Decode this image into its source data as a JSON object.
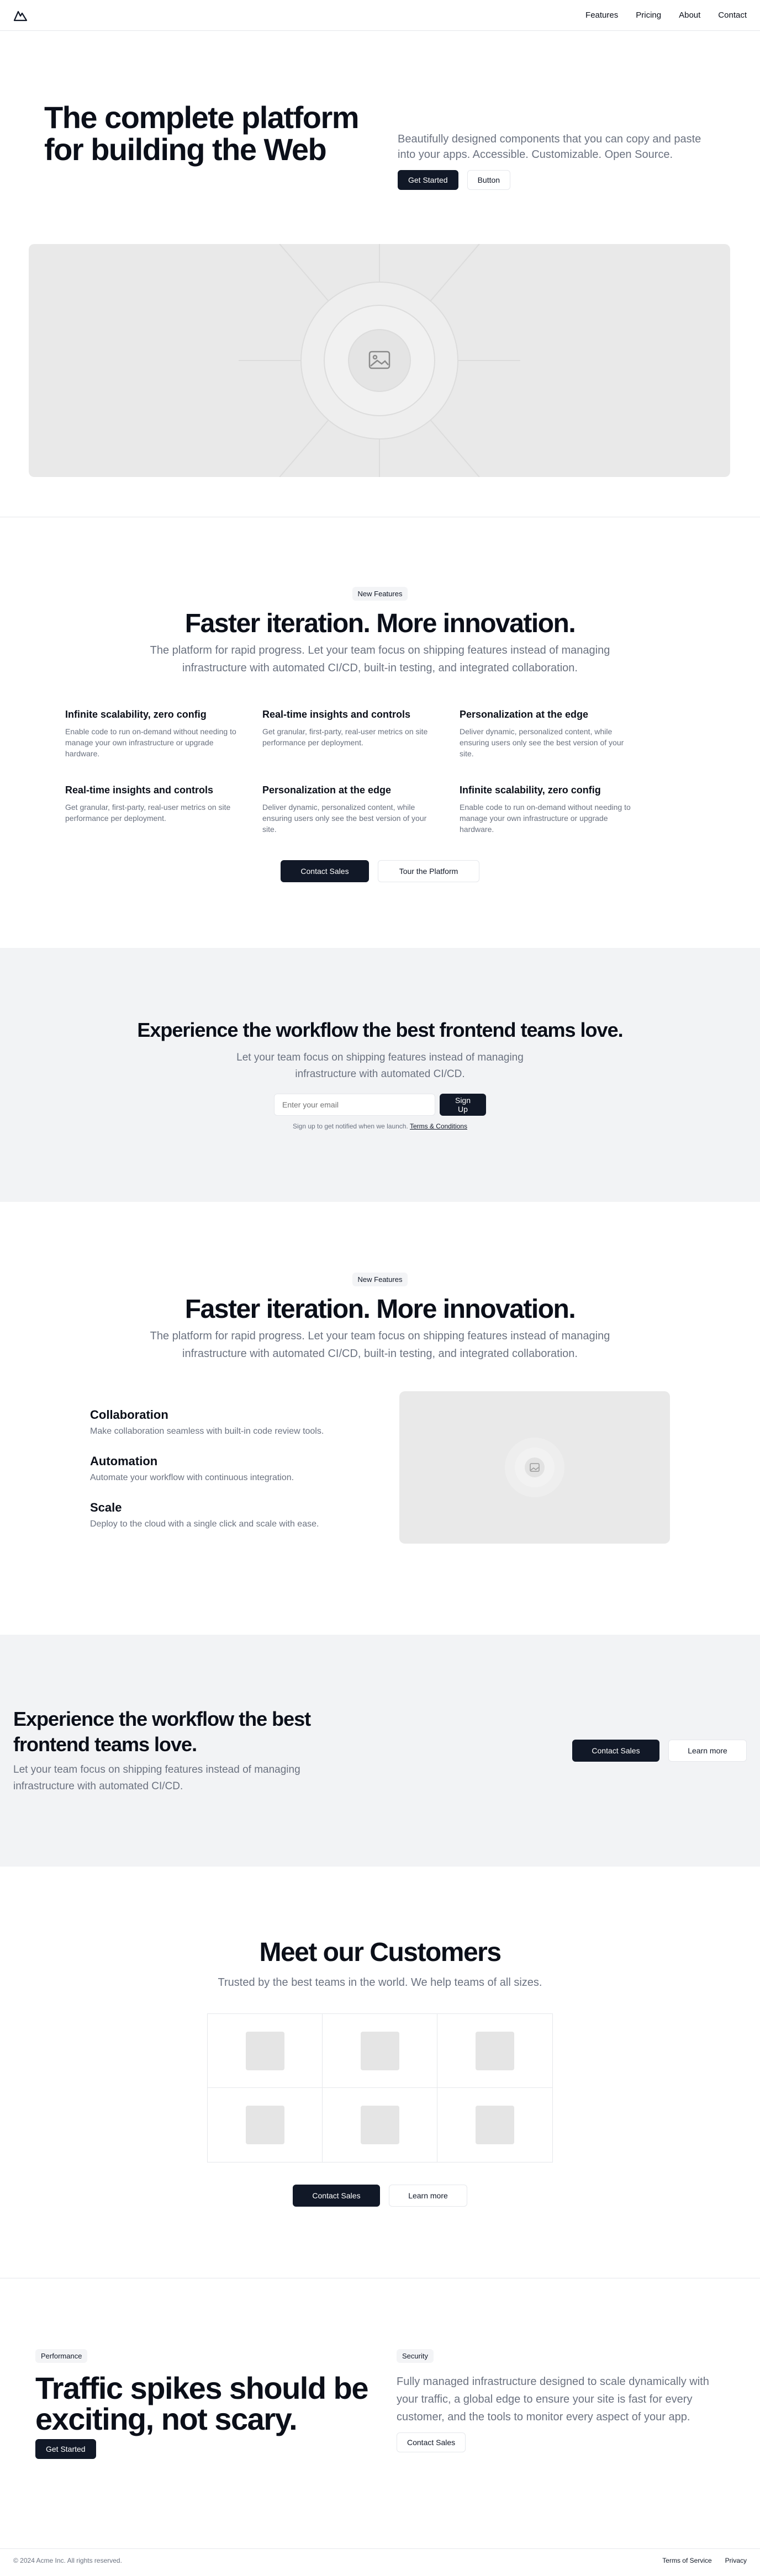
{
  "nav": {
    "links": [
      "Features",
      "Pricing",
      "About",
      "Contact"
    ]
  },
  "hero": {
    "title": "The complete platform for building the Web",
    "subtitle": "Beautifully designed components that you can copy and paste into your apps. Accessible. Customizable. Open Source.",
    "primary": "Get Started",
    "secondary": "Button",
    "image_icon": "image-icon"
  },
  "features": {
    "badge": "New Features",
    "title": "Faster iteration. More innovation.",
    "lead": "The platform for rapid progress. Let your team focus on shipping features instead of managing infrastructure with automated CI/CD, built-in testing, and integrated collaboration.",
    "items": [
      {
        "title": "Infinite scalability, zero config",
        "desc": "Enable code to run on-demand without needing to manage your own infrastructure or upgrade hardware."
      },
      {
        "title": "Real-time insights and controls",
        "desc": "Get granular, first-party, real-user metrics on site performance per deployment."
      },
      {
        "title": "Personalization at the edge",
        "desc": "Deliver dynamic, personalized content, while ensuring users only see the best version of your site."
      },
      {
        "title": "Real-time insights and controls",
        "desc": "Get granular, first-party, real-user metrics on site performance per deployment."
      },
      {
        "title": "Personalization at the edge",
        "desc": "Deliver dynamic, personalized content, while ensuring users only see the best version of your site."
      },
      {
        "title": "Infinite scalability, zero config",
        "desc": "Enable code to run on-demand without needing to manage your own infrastructure or upgrade hardware."
      }
    ],
    "primary": "Contact Sales",
    "secondary": "Tour the Platform"
  },
  "email": {
    "title": "Experience the workflow the best frontend teams love.",
    "lead": "Let your team focus on shipping features instead of managing infrastructure with automated CI/CD.",
    "placeholder": "Enter your email",
    "button": "Sign Up",
    "note": "Sign up to get notified when we launch.",
    "note_link": "Terms & Conditions"
  },
  "features2": {
    "badge": "New Features",
    "title": "Faster iteration. More innovation.",
    "lead": "The platform for rapid progress. Let your team focus on shipping features instead of managing infrastructure with automated CI/CD, built-in testing, and integrated collaboration.",
    "items": [
      {
        "title": "Collaboration",
        "desc": "Make collaboration seamless with built-in code review tools."
      },
      {
        "title": "Automation",
        "desc": "Automate your workflow with continuous integration."
      },
      {
        "title": "Scale",
        "desc": "Deploy to the cloud with a single click and scale with ease."
      }
    ]
  },
  "cta": {
    "title": "Experience the workflow the best frontend teams love.",
    "lead": "Let your team focus on shipping features instead of managing infrastructure with automated CI/CD.",
    "primary": "Contact Sales",
    "secondary": "Learn more"
  },
  "customers": {
    "title": "Meet our Customers",
    "lead": "Trusted by the best teams in the world. We help teams of all sizes.",
    "primary": "Contact Sales",
    "secondary": "Learn more"
  },
  "traffic": {
    "badge": "Performance",
    "title": "Traffic spikes should be exciting, not scary.",
    "button": "Get Started",
    "right_badge": "Security",
    "right_lead": "Fully managed infrastructure designed to scale dynamically with your traffic, a global edge to ensure your site is fast for every customer, and the tools to monitor every aspect of your app.",
    "right_button": "Contact Sales"
  },
  "footer": {
    "copy": "© 2024 Acme Inc. All rights reserved.",
    "links": [
      "Terms of Service",
      "Privacy"
    ]
  }
}
